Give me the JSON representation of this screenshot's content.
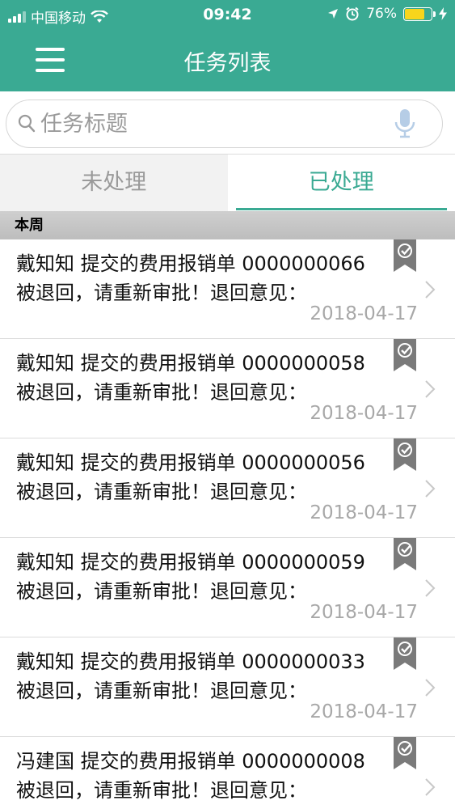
{
  "status_bar": {
    "carrier": "中国移动",
    "time": "09:42",
    "battery": "76%",
    "battery_level": 0.76,
    "icons": [
      "signal-icon",
      "wifi-icon",
      "location-icon",
      "alarm-icon",
      "battery-icon",
      "charging-icon"
    ]
  },
  "header": {
    "title": "任务列表",
    "menu_icon": "menu-icon"
  },
  "search": {
    "placeholder": "任务标题",
    "value": "",
    "search_icon": "search-icon",
    "mic_icon": "mic-icon"
  },
  "tabs": [
    {
      "label": "未处理",
      "active": false
    },
    {
      "label": "已处理",
      "active": true
    }
  ],
  "section": {
    "label": "本周"
  },
  "items": [
    {
      "text": "戴知知 提交的费用报销单 0000000066 被退回，请重新审批！退回意见：",
      "date": "2018-04-17"
    },
    {
      "text": "戴知知 提交的费用报销单 0000000058 被退回，请重新审批！退回意见：",
      "date": "2018-04-17"
    },
    {
      "text": "戴知知 提交的费用报销单 0000000056 被退回，请重新审批！退回意见：",
      "date": "2018-04-17"
    },
    {
      "text": "戴知知 提交的费用报销单 0000000059 被退回，请重新审批！退回意见：",
      "date": "2018-04-17"
    },
    {
      "text": "戴知知 提交的费用报销单 0000000033 被退回，请重新审批！退回意见：",
      "date": "2018-04-17"
    },
    {
      "text": "冯建国 提交的费用报销单 0000000008 被退回，请重新审批！退回意见：",
      "date": ""
    }
  ],
  "colors": {
    "brand": "#3aaa93",
    "badge": "#7a7a7a",
    "date_text": "#a8a8a8",
    "battery_fill": "#f7d51c"
  }
}
